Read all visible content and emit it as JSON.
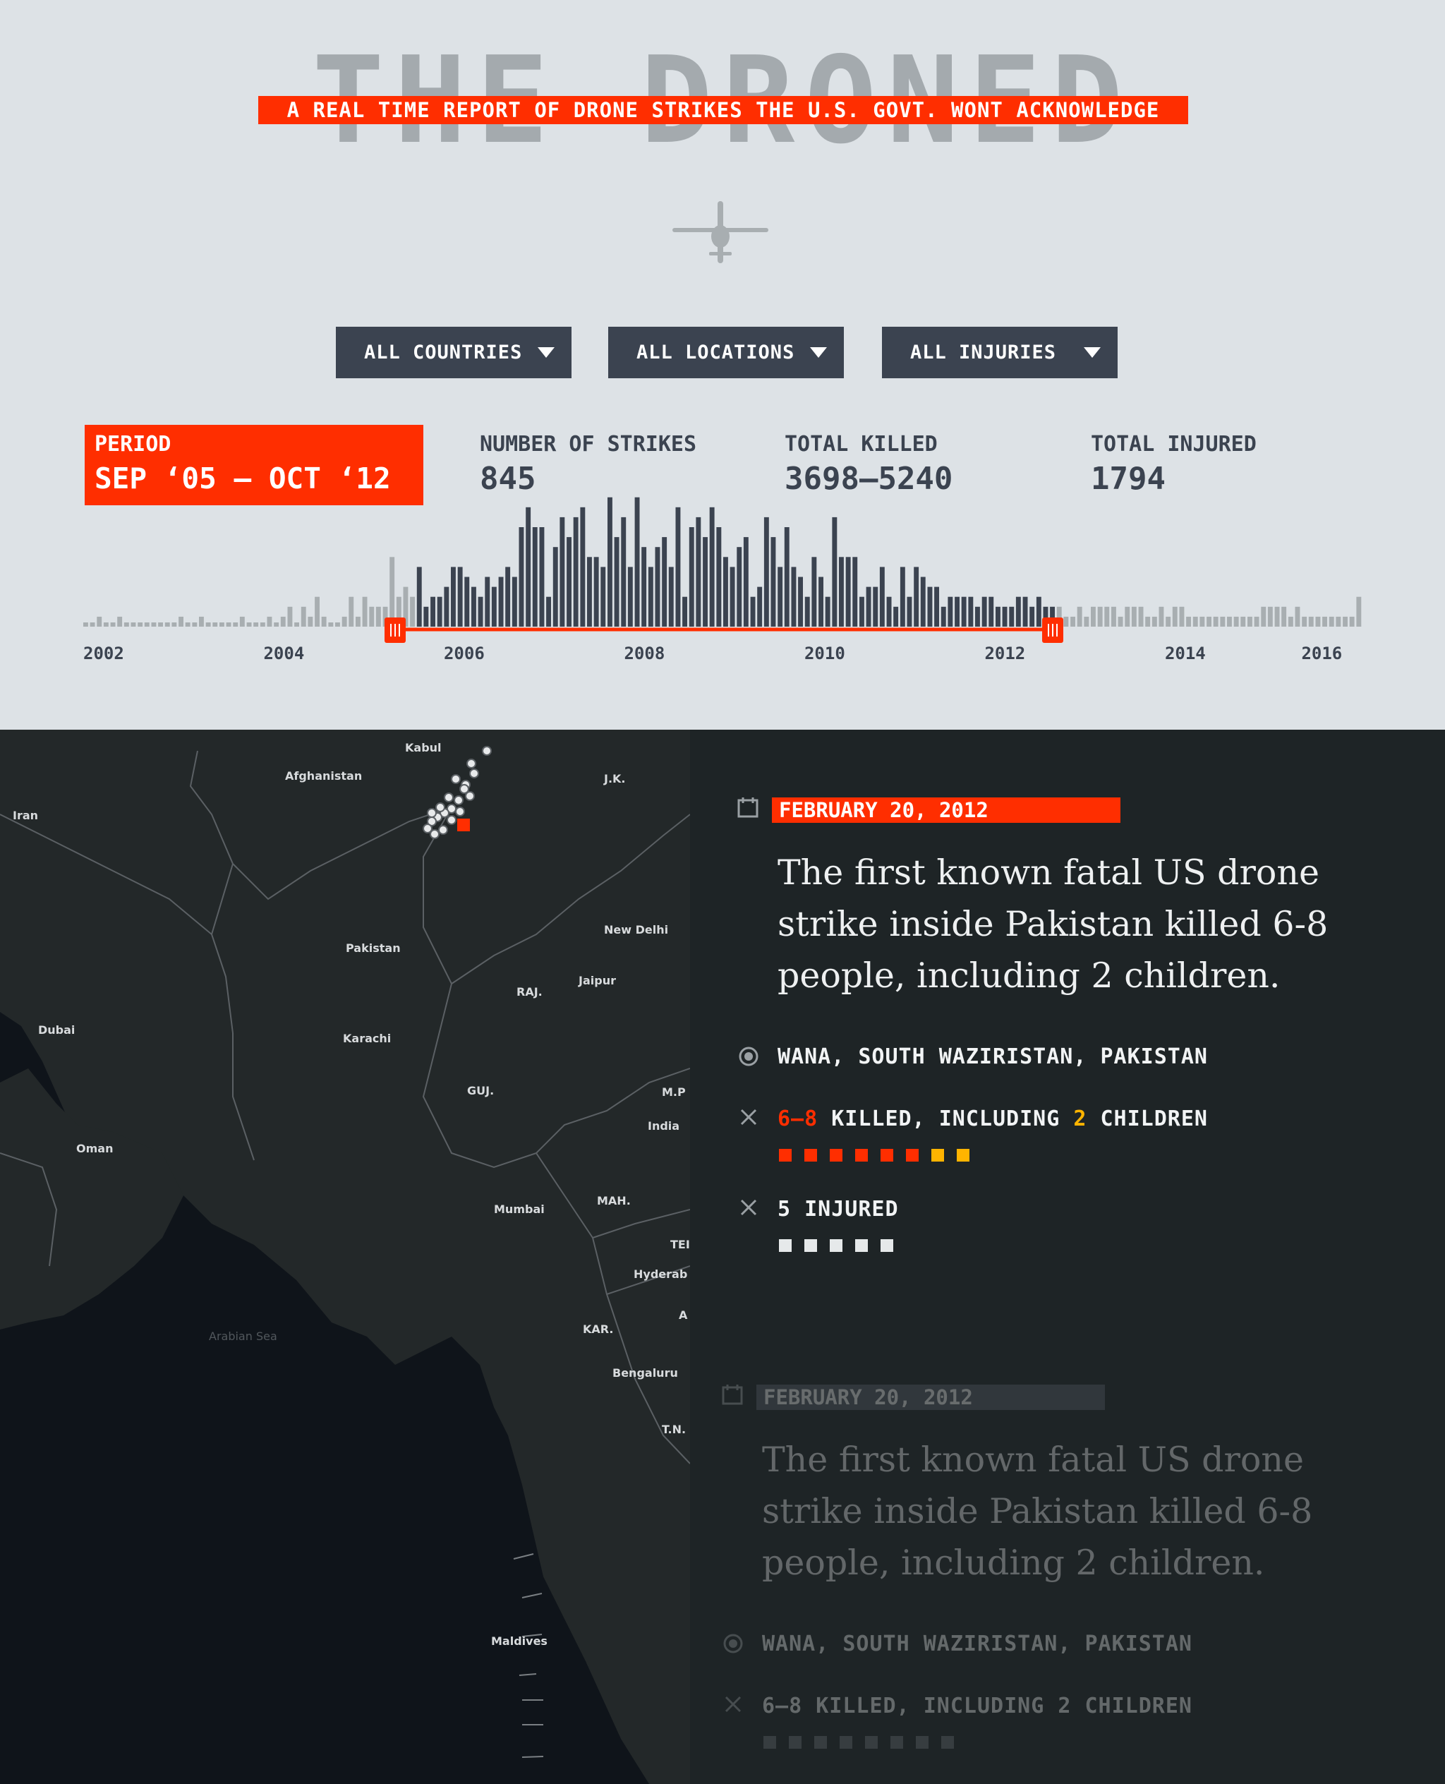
{
  "header": {
    "title": "THE DRONED",
    "tagline": "A REAL TIME REPORT OF DRONE STRIKES THE U.S. GOVT. WONT ACKNOWLEDGE"
  },
  "filters": [
    {
      "label": "ALL COUNTRIES"
    },
    {
      "label": "ALL LOCATIONS"
    },
    {
      "label": "ALL INJURIES"
    }
  ],
  "stats": {
    "period_label": "PERIOD",
    "period_value": "SEP ‘05 — OCT ‘12",
    "strikes_label": "NUMBER OF STRIKES",
    "strikes_value": "845",
    "killed_label": "TOTAL KILLED",
    "killed_value": "3698–5240",
    "injured_label": "TOTAL INJURED",
    "injured_value": "1794"
  },
  "colors": {
    "accent": "#ff2e00",
    "bar_active": "#3b4350",
    "bar_inactive": "#a8aeb1",
    "child": "#ffb400"
  },
  "chart_data": {
    "type": "bar",
    "x_start": 2002.0,
    "x_end": 2016.2,
    "x_ticks": [
      "2002",
      "2004",
      "2006",
      "2008",
      "2010",
      "2012",
      "2014",
      "2016"
    ],
    "selection": [
      "2005-09",
      "2012-10"
    ],
    "values": [
      0,
      0,
      1,
      0,
      0,
      1,
      0,
      0,
      0,
      0,
      0,
      0,
      0,
      0,
      1,
      0,
      0,
      1,
      0,
      0,
      0,
      0,
      0,
      1,
      0,
      0,
      0,
      1,
      0,
      1,
      2,
      0,
      2,
      1,
      3,
      1,
      0,
      0,
      1,
      3,
      1,
      3,
      2,
      2,
      2,
      7,
      3,
      4,
      3,
      6,
      2,
      3,
      3,
      4,
      6,
      6,
      5,
      4,
      3,
      5,
      4,
      5,
      6,
      5,
      10,
      12,
      10,
      10,
      3,
      8,
      11,
      9,
      11,
      12,
      7,
      7,
      6,
      13,
      9,
      11,
      6,
      13,
      8,
      6,
      8,
      9,
      6,
      12,
      3,
      10,
      11,
      9,
      12,
      10,
      7,
      6,
      8,
      9,
      3,
      4,
      11,
      9,
      6,
      10,
      6,
      5,
      3,
      7,
      5,
      3,
      11,
      7,
      7,
      7,
      3,
      4,
      4,
      6,
      3,
      2,
      6,
      3,
      6,
      5,
      4,
      4,
      2,
      3,
      3,
      3,
      3,
      2,
      3,
      3,
      2,
      2,
      2,
      3,
      3,
      2,
      3,
      2,
      2,
      2,
      1,
      1,
      2,
      1,
      2,
      2,
      2,
      2,
      1,
      2,
      2,
      2,
      1,
      1,
      2,
      1,
      2,
      2,
      1,
      1,
      1,
      1,
      1,
      1,
      1,
      1,
      1,
      1,
      1,
      2,
      2,
      2,
      2,
      1,
      2,
      1,
      1,
      1,
      1,
      1,
      1,
      1,
      1,
      3
    ]
  },
  "map": {
    "labels": [
      {
        "text": "Kabul",
        "size": 17
      },
      {
        "text": "Afghanistan",
        "size": 27
      },
      {
        "text": "Iran",
        "size": 27
      },
      {
        "text": "J.K.",
        "size": 16
      },
      {
        "text": "Pakistan",
        "size": 27
      },
      {
        "text": "New Delhi",
        "size": 19
      },
      {
        "text": "Jaipur",
        "size": 19
      },
      {
        "text": "RAJ.",
        "size": 16
      },
      {
        "text": "Dubai",
        "size": 19
      },
      {
        "text": "Karachi",
        "size": 19
      },
      {
        "text": "GUJ.",
        "size": 16
      },
      {
        "text": "M.P",
        "size": 16
      },
      {
        "text": "India",
        "size": 27
      },
      {
        "text": "Oman",
        "size": 27
      },
      {
        "text": "Mumbai",
        "size": 19
      },
      {
        "text": "MAH.",
        "size": 16
      },
      {
        "text": "TEI",
        "size": 16
      },
      {
        "text": "Hyderab",
        "size": 19
      },
      {
        "text": "A",
        "size": 16
      },
      {
        "text": "Arabian Sea",
        "size": 30
      },
      {
        "text": "KAR.",
        "size": 16
      },
      {
        "text": "Bengaluru",
        "size": 19
      },
      {
        "text": "T.N.",
        "size": 16
      },
      {
        "text": "Maldives",
        "size": 27
      }
    ]
  },
  "events": [
    {
      "date": "FEBRUARY 20, 2012",
      "headline": "The first known fatal US drone strike inside Pakistan killed 6-8 people, including 2 children.",
      "location": "WANA, SOUTH WAZIRISTAN, PAKISTAN",
      "killed_range": "6–8",
      "killed_mid": "KILLED, INCLUDING",
      "children": "2",
      "children_word": "CHILDREN",
      "killed_count": 8,
      "children_count": 2,
      "injured_text": "5 INJURED",
      "injured_count": 5
    },
    {
      "date": "FEBRUARY 20, 2012",
      "headline": "The first known fatal US drone strike inside Pakistan killed 6-8 people, including 2 children.",
      "location": "WANA, SOUTH WAZIRISTAN, PAKISTAN",
      "killed_text": "6–8 KILLED, INCLUDING 2 CHILDREN",
      "killed_count": 8
    }
  ]
}
